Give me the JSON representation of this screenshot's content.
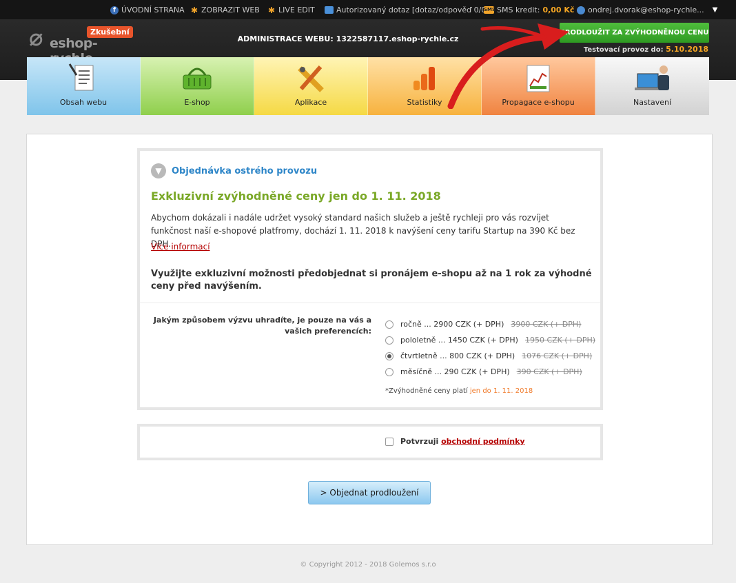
{
  "topbar": {
    "home": "ÚVODNÍ STRANA",
    "show_web": "ZOBRAZIT WEB",
    "live_edit": "LIVE EDIT",
    "query": "Autorizovaný dotaz [dotaz/odpověď 0/0]",
    "sms_icon": "SMS",
    "sms_label": "SMS kredit:",
    "sms_value": "0,00 Kč",
    "user": "ondrej.dvorak@eshop-rychle..."
  },
  "header": {
    "logo_text": "eshop-rychle",
    "logo_badge": "Zkušební",
    "admin_title": "ADMINISTRACE WEBU: 1322587117.eshop-rychle.cz",
    "prolong_button": "PRODLOUŽIT ZA ZVÝHODNĚNOU CENU",
    "test_label": "Testovací provoz do:",
    "test_date": "5.10.2018"
  },
  "nav": {
    "items": [
      {
        "label": "Obsah webu"
      },
      {
        "label": "E-shop"
      },
      {
        "label": "Aplikace"
      },
      {
        "label": "Statistiky"
      },
      {
        "label": "Propagace e-shopu"
      },
      {
        "label": "Nastavení"
      }
    ]
  },
  "order": {
    "title": "Objednávka ostrého provozu",
    "promo": "Exkluzivní zvýhodněné ceny jen do 1. 11. 2018",
    "paragraph": "Abychom dokázali i nadále udržet vysoký standard našich služeb a ještě rychleji pro vás rozvíjet funkčnost naší e-shopové platfromy, dochází 1. 11. 2018 k navýšení ceny tarifu Startup na 390 Kč bez DPH.",
    "more_info": "Více informací",
    "bold_paragraph": "Využijte exkluzivní možnosti předobjednat si pronájem e-shopu až na 1 rok za výhodné ceny před navýšením.",
    "question": "Jakým způsobem výzvu uhradíte, je pouze na vás a vašich preferencích:",
    "options": [
      {
        "label": "ročně ... 2900 CZK (+ DPH)",
        "old": "3900 CZK (+ DPH)",
        "selected": false
      },
      {
        "label": "pololetně ... 1450 CZK (+ DPH)",
        "old": "1950 CZK (+ DPH)",
        "selected": false
      },
      {
        "label": "čtvrtletně ... 800 CZK (+ DPH)",
        "old": "1076 CZK (+ DPH)",
        "selected": true
      },
      {
        "label": "měsíčně ... 290 CZK (+ DPH)",
        "old": "390 CZK (+ DPH)",
        "selected": false
      }
    ],
    "note_prefix": "*Zvýhodněné ceny platí",
    "note_highlight": "jen do 1. 11. 2018"
  },
  "terms": {
    "label": "Potvrzuji",
    "link": "obchodní podmínky"
  },
  "order_button": "> Objednat prodloužení",
  "footer": "© Copyright 2012 - 2018 Golemos s.r.o",
  "colors": {
    "accent_blue": "#2e86c8",
    "promo_green": "#7aa827",
    "link_red": "#b50000",
    "highlight_orange": "#f07a2a",
    "button_green": "#3aa82c"
  }
}
